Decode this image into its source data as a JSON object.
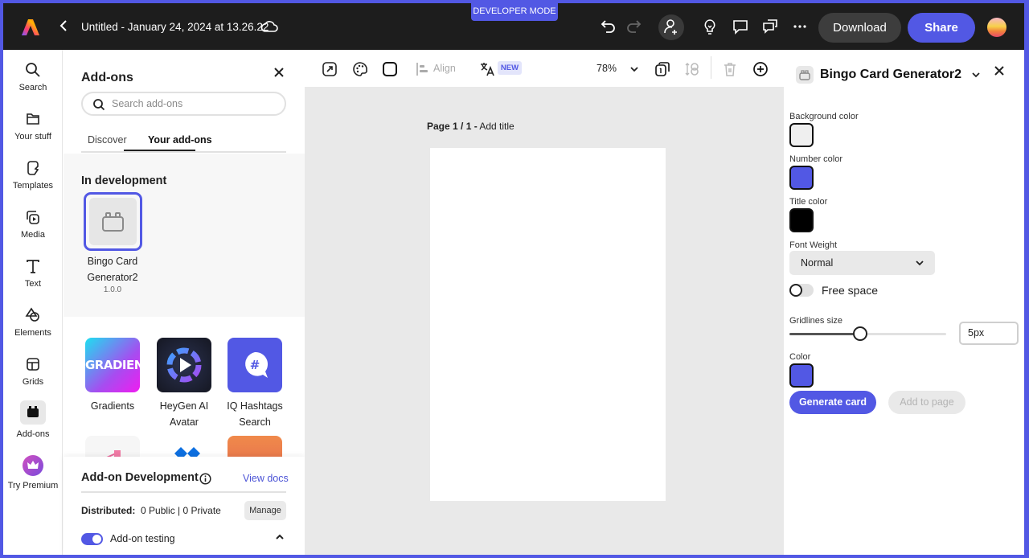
{
  "topbar": {
    "developer_mode": "DEVELOPER MODE",
    "document_title": "Untitled - January 24, 2024 at 13.26.22",
    "download_label": "Download",
    "share_label": "Share",
    "accent_color": "#5258e4"
  },
  "rail": {
    "items": [
      {
        "label": "Search",
        "icon": "search-icon"
      },
      {
        "label": "Your stuff",
        "icon": "folder-icon"
      },
      {
        "label": "Templates",
        "icon": "templates-icon"
      },
      {
        "label": "Media",
        "icon": "media-icon"
      },
      {
        "label": "Text",
        "icon": "text-icon"
      },
      {
        "label": "Elements",
        "icon": "shapes-icon"
      },
      {
        "label": "Grids",
        "icon": "grid-icon"
      },
      {
        "label": "Add-ons",
        "icon": "addons-icon",
        "active": true
      },
      {
        "label": "Try Premium",
        "icon": "crown-icon"
      }
    ]
  },
  "addons_panel": {
    "title": "Add-ons",
    "search_placeholder": "Search add-ons",
    "tabs": [
      {
        "label": "Discover",
        "active": false
      },
      {
        "label": "Your add-ons",
        "active": true
      }
    ],
    "in_development": {
      "heading": "In development",
      "item": {
        "name_line1": "Bingo Card",
        "name_line2": "Generator2",
        "version": "1.0.0"
      }
    },
    "addons": [
      {
        "name_line1": "Gradients",
        "name_line2": "",
        "tile_text": "GRADIENTS"
      },
      {
        "name_line1": "HeyGen AI",
        "name_line2": "Avatar",
        "tile_text": ""
      },
      {
        "name_line1": "IQ Hashtags",
        "name_line2": "Search",
        "tile_text": "#"
      }
    ],
    "development": {
      "title": "Add-on Development",
      "view_docs": "View docs",
      "distributed_label": "Distributed:",
      "distributed_value": "0 Public | 0 Private",
      "manage_label": "Manage",
      "testing_label": "Add-on testing",
      "testing_enabled": true
    }
  },
  "toolbar": {
    "align_label": "Align",
    "new_badge": "NEW",
    "zoom_value": "78%"
  },
  "canvas": {
    "page_label": "Page 1 / 1 -",
    "page_title_placeholder": "Add title"
  },
  "bingo_panel": {
    "title": "Bingo Card Generator2",
    "background_color_label": "Background color",
    "background_color": "#efefef",
    "number_color_label": "Number color",
    "number_color": "#5258e4",
    "title_color_label": "Title color",
    "title_color": "#000000",
    "font_weight_label": "Font Weight",
    "font_weight_value": "Normal",
    "free_space_label": "Free space",
    "free_space_enabled": false,
    "gridlines_label": "Gridlines size",
    "gridlines_value": "5px",
    "gridlines_slider_fraction": 0.45,
    "color_label": "Color",
    "grid_color": "#5258e4",
    "generate_label": "Generate card",
    "add_to_page_label": "Add to page"
  }
}
